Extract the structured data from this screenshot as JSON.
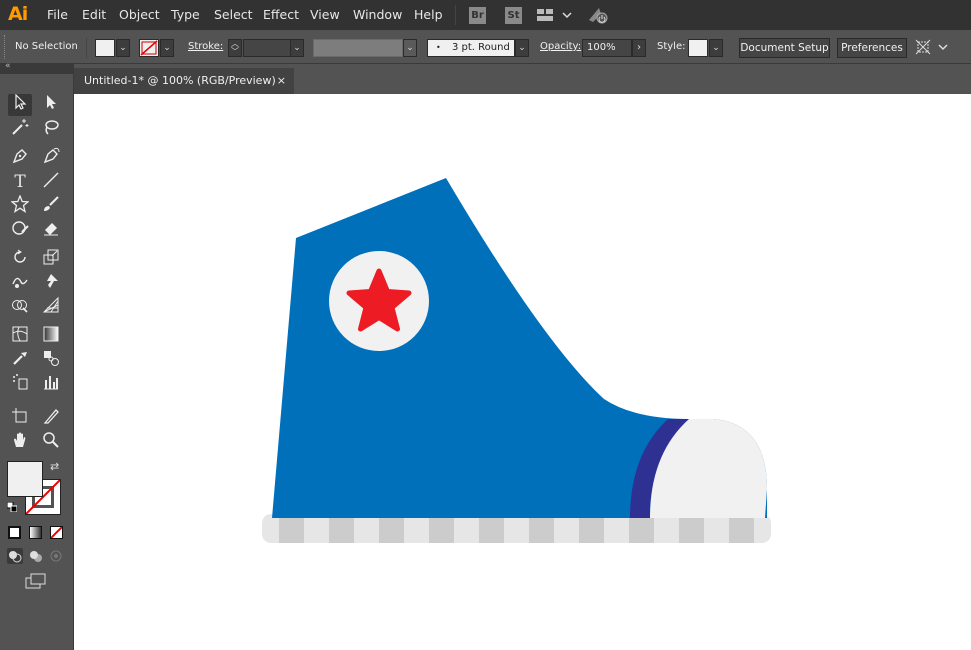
{
  "app": {
    "logo": "Ai",
    "brand_color": "#FF9A00"
  },
  "menu": [
    "File",
    "Edit",
    "Object",
    "Type",
    "Select",
    "Effect",
    "View",
    "Window",
    "Help"
  ],
  "menu_badges": {
    "bridge": "Br",
    "stock": "St"
  },
  "control_bar": {
    "selection": "No Selection",
    "stroke_label": "Stroke:",
    "brush": "3 pt. Round",
    "opacity_label": "Opacity:",
    "opacity_value": "100%",
    "style_label": "Style:",
    "document_setup": "Document Setup",
    "preferences": "Preferences"
  },
  "document": {
    "tab_title": "Untitled-1* @ 100% (RGB/Preview)",
    "close": "×"
  },
  "artwork_colors": {
    "shoe": "#0070BB",
    "band": "#2E3192",
    "star": "#ED1C24",
    "toe": "#F1F1F2",
    "sole_light": "#E6E6E6",
    "sole_dark": "#CCCCCC"
  }
}
